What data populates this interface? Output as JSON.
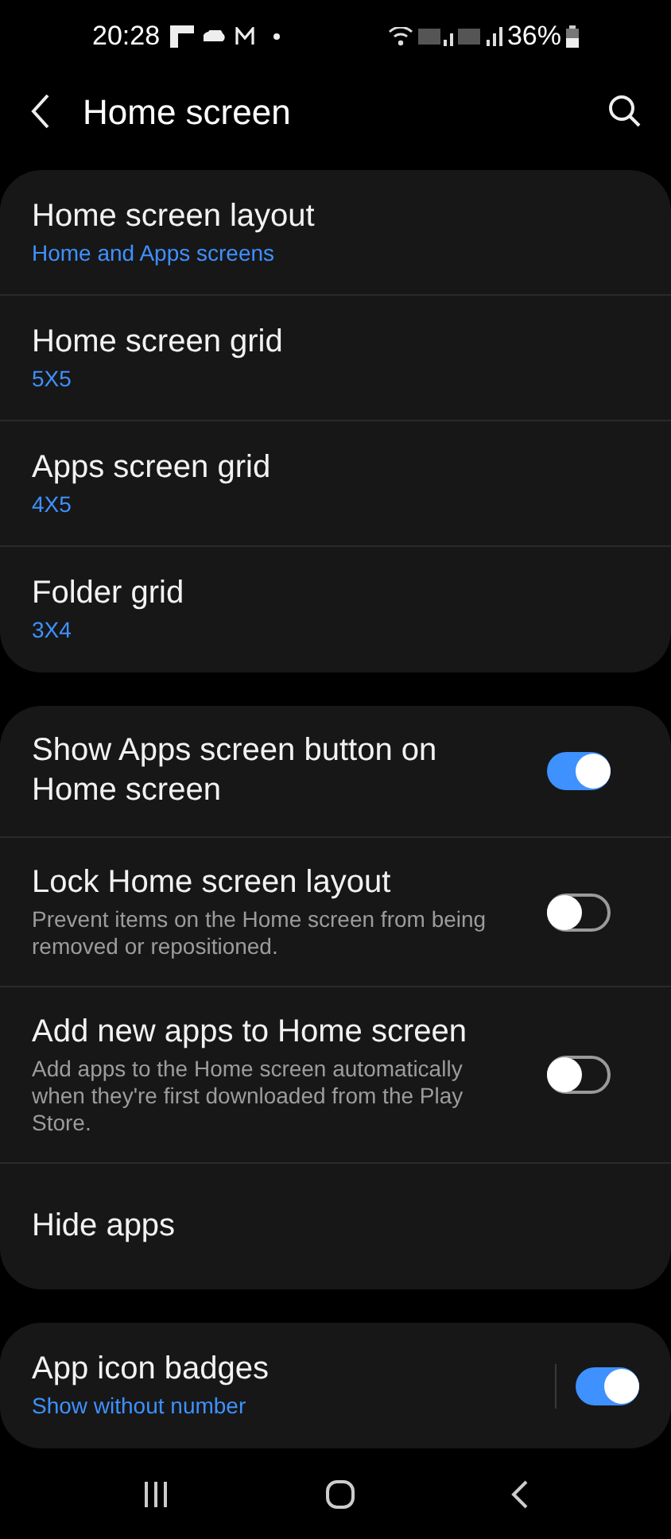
{
  "status_bar": {
    "time": "20:28",
    "battery": "36%"
  },
  "header": {
    "title": "Home screen"
  },
  "groups": [
    {
      "items": [
        {
          "kind": "link",
          "title": "Home screen layout",
          "subtitle": "Home and Apps screens"
        },
        {
          "kind": "link",
          "title": "Home screen grid",
          "subtitle": "5X5"
        },
        {
          "kind": "link",
          "title": "Apps screen grid",
          "subtitle": "4X5"
        },
        {
          "kind": "link",
          "title": "Folder grid",
          "subtitle": "3X4"
        }
      ]
    },
    {
      "items": [
        {
          "kind": "toggle",
          "title": "Show Apps screen button on Home screen",
          "on": true
        },
        {
          "kind": "toggle",
          "title": "Lock Home screen layout",
          "description": "Prevent items on the Home screen from being removed or repositioned.",
          "on": false
        },
        {
          "kind": "toggle",
          "title": "Add new apps to Home screen",
          "description": "Add apps to the Home screen automatically when they're first downloaded from the Play Store.",
          "on": false
        },
        {
          "kind": "link",
          "title": "Hide apps"
        }
      ]
    },
    {
      "items": [
        {
          "kind": "split-toggle",
          "title": "App icon badges",
          "subtitle": "Show without number",
          "on": true
        }
      ]
    }
  ]
}
